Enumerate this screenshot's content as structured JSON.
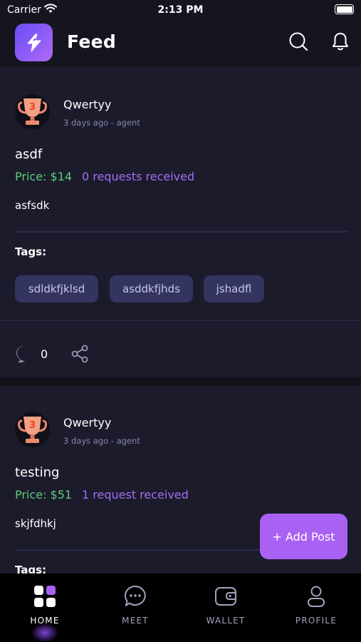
{
  "status_bar": {
    "carrier": "Carrier",
    "time": "2:13 PM"
  },
  "header": {
    "title": "Feed"
  },
  "posts": [
    {
      "author": "Qwertyy",
      "meta": "3 days ago - agent",
      "title": "asdf",
      "price": "Price: $14",
      "requests": "0 requests received",
      "description": "asfsdk",
      "tags_label": "Tags:",
      "tags": [
        "sdldkfjklsd",
        "asddkfjhds",
        "jshadfl"
      ],
      "comment_count": "0"
    },
    {
      "author": "Qwertyy",
      "meta": "3 days ago - agent",
      "title": "testing",
      "price": "Price: $51",
      "requests": "1 request received",
      "description": "skjfdhkj",
      "tags_label": "Tags:"
    }
  ],
  "fab": {
    "label": "+ Add Post"
  },
  "bottom_nav": {
    "items": [
      {
        "label": "HOME",
        "icon": "home-grid-icon",
        "active": true
      },
      {
        "label": "MEET",
        "icon": "chat-bubble-icon",
        "active": false
      },
      {
        "label": "WALLET",
        "icon": "wallet-icon",
        "active": false
      },
      {
        "label": "PROFILE",
        "icon": "profile-icon",
        "active": false
      }
    ]
  },
  "colors": {
    "accent": "#a961f4",
    "price": "#5dcb7a",
    "requests": "#a36ff2",
    "tag_bg": "#33345f",
    "card_bg": "#1b1b2c"
  }
}
